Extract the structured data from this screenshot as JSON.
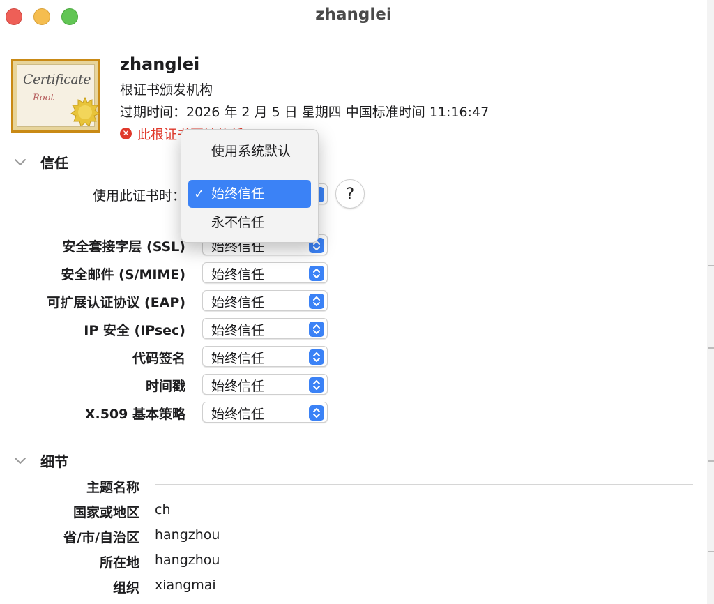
{
  "window": {
    "title": "zhanglei"
  },
  "certificate": {
    "image_text": "Certificate",
    "image_subtext": "Root",
    "name": "zhanglei",
    "kind": "根证书颁发机构",
    "expiry": "过期时间：2026 年 2 月 5 日 星期四 中国标准时间 11:16:47",
    "warning": "此根证书不被信任"
  },
  "trust": {
    "section_label": "信任",
    "when_using_label": "使用此证书时：",
    "rows": [
      {
        "label": "安全套接字层 (SSL)",
        "value": "始终信任"
      },
      {
        "label": "安全邮件 (S/MIME)",
        "value": "始终信任"
      },
      {
        "label": "可扩展认证协议 (EAP)",
        "value": "始终信任"
      },
      {
        "label": "IP 安全 (IPsec)",
        "value": "始终信任"
      },
      {
        "label": "代码签名",
        "value": "始终信任"
      },
      {
        "label": "时间戳",
        "value": "始终信任"
      },
      {
        "label": "X.509 基本策略",
        "value": "始终信任"
      }
    ],
    "help_label": "?"
  },
  "dropdown_menu": {
    "items": [
      {
        "label": "使用系统默认",
        "selected": false
      },
      {
        "label": "始终信任",
        "selected": true
      },
      {
        "label": "永不信任",
        "selected": false
      }
    ],
    "check_mark": "✓"
  },
  "details": {
    "section_label": "细节",
    "subject_name_label": "主题名称",
    "fields": [
      {
        "label": "国家或地区",
        "value": "ch"
      },
      {
        "label": "省/市/自治区",
        "value": "hangzhou"
      },
      {
        "label": "所在地",
        "value": "hangzhou"
      },
      {
        "label": "组织",
        "value": "xiangmai"
      }
    ]
  },
  "colors": {
    "accent": "#3b82f6",
    "warning": "#e0392b",
    "close": "#ee5f57",
    "minimize": "#f5bd4f",
    "zoom": "#61c554"
  }
}
